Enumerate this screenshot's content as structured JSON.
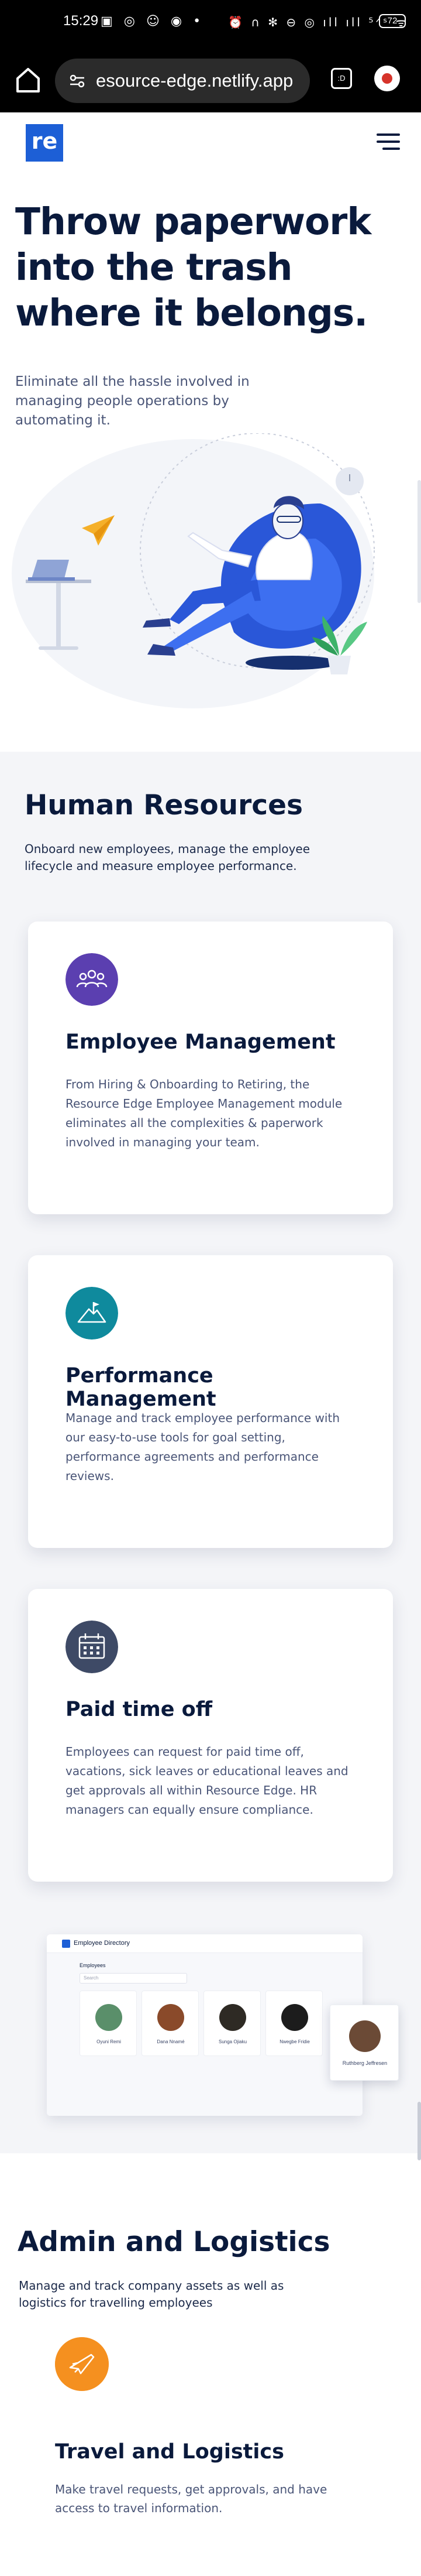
{
  "status_bar": {
    "time": "15:29",
    "battery": "72",
    "left_icons": "▣ ◎ ☺ ◉ •",
    "right_icons": "⏰ ∩ ✻ ⊖ ◎ ıll ıll ⁵ᐟˢ ᯤ"
  },
  "browser": {
    "url": "esource-edge.netlify.app",
    "tabs_count": ":D"
  },
  "site": {
    "logo_text": "re"
  },
  "hero": {
    "title": "Throw paperwork into the trash where it belongs.",
    "subtitle": "Eliminate all the hassle involved in managing people operations by automating it."
  },
  "hr": {
    "title": "Human Resources",
    "subtitle": "Onboard new employees, manage the employee lifecycle and measure employee performance.",
    "cards": [
      {
        "title": "Employee Management",
        "text": "From Hiring & Onboarding to Retiring, the Resource Edge Employee Management module eliminates all the complexities & paperwork involved in managing your team.",
        "icon": "team-icon",
        "color": "#5b3fb0"
      },
      {
        "title": "Performance Management",
        "text": "Manage and track employee performance with our easy-to-use tools for goal setting, performance agreements and performance reviews.",
        "icon": "mountain-flag-icon",
        "color": "#0f8a9d"
      },
      {
        "title": "Paid time off",
        "text": "Employees can request for paid time off, vacations, sick leaves or educational leaves and get approvals all within Resource Edge. HR managers can equally ensure compliance.",
        "icon": "calendar-icon",
        "color": "#3e4a66"
      }
    ]
  },
  "directory_mock": {
    "title": "Employee Directory",
    "heading": "Employees",
    "search_placeholder": "Search",
    "employees": [
      {
        "name": "Oyuni Remi",
        "color": "#5a8f6a"
      },
      {
        "name": "Dana Nnamé",
        "color": "#8a4a2a"
      },
      {
        "name": "Sunga Ojiaku",
        "color": "#2e2a24"
      },
      {
        "name": "Nwegbe Fridie",
        "color": "#1c1c1c"
      },
      {
        "name": "Ruthberg Jeffresen",
        "color": "#6b4a36"
      }
    ]
  },
  "admin": {
    "title": "Admin and Logistics",
    "subtitle": "Manage and track company assets as well as logistics for travelling employees",
    "travel": {
      "title": "Travel and Logistics",
      "text": "Make travel requests, get approvals, and have access to travel information.",
      "icon": "airplane-icon",
      "color": "#f5901f"
    }
  }
}
